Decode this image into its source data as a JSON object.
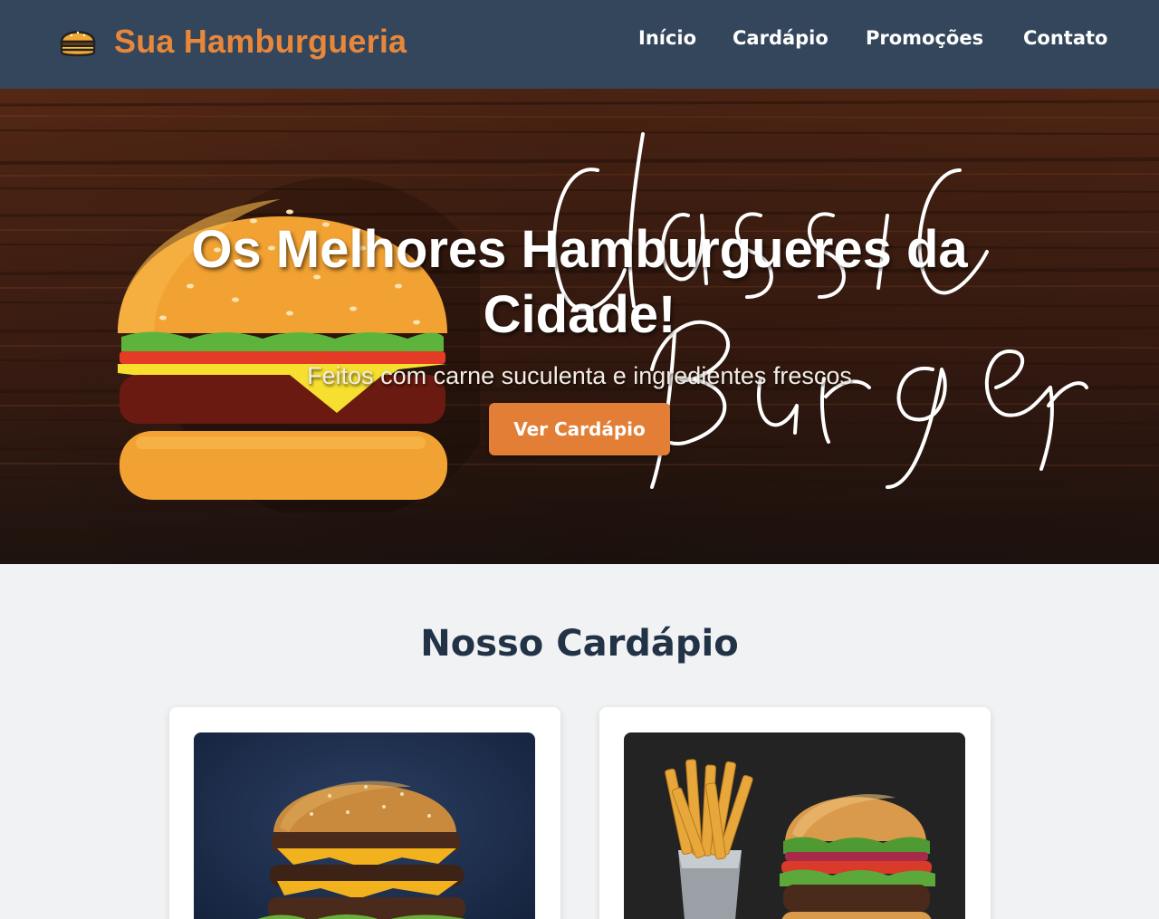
{
  "header": {
    "brand_icon": "burger-icon",
    "brand_title": "Sua Hamburgueria",
    "nav": [
      {
        "label": "Início"
      },
      {
        "label": "Cardápio"
      },
      {
        "label": "Promoções"
      },
      {
        "label": "Contato"
      }
    ]
  },
  "hero": {
    "title": "Os Melhores Hamburgueres da Cidade!",
    "subtitle": "Feitos com carne suculenta e ingredientes frescos",
    "cta_label": "Ver Cardápio",
    "script_text": "Classic Burger"
  },
  "menu": {
    "title": "Nosso Cardápio",
    "cards": [
      {
        "image": "double-cheeseburger-photo"
      },
      {
        "image": "burger-and-fries-photo"
      }
    ]
  },
  "colors": {
    "header_bg": "#34465c",
    "brand_accent": "#e8873a",
    "cta_bg": "#e27e36",
    "section_title": "#233347",
    "page_bg": "#f1f2f3"
  }
}
